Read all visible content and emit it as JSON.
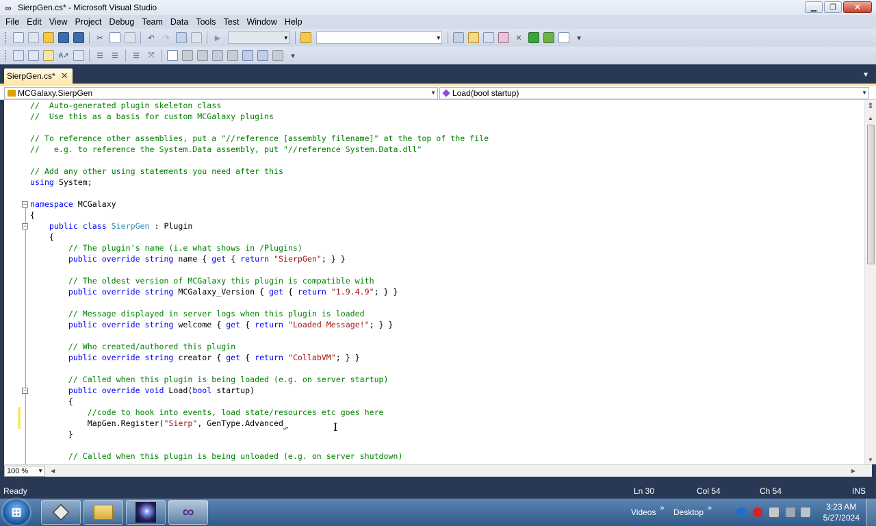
{
  "window": {
    "title": "SierpGen.cs* - Microsoft Visual Studio",
    "controls": {
      "minimize": "▁",
      "maximize": "❐",
      "close": "✕"
    }
  },
  "menu": [
    "File",
    "Edit",
    "View",
    "Project",
    "Debug",
    "Team",
    "Data",
    "Tools",
    "Test",
    "Window",
    "Help"
  ],
  "document_tab": {
    "label": "SierpGen.cs*",
    "close": "✕"
  },
  "navbar": {
    "type_selector": "MCGalaxy.SierpGen",
    "member_selector": "Load(bool startup)"
  },
  "code_lines": [
    [
      [
        "cm",
        "//  Auto-generated plugin skeleton class"
      ]
    ],
    [
      [
        "cm",
        "//  Use this as a basis for custom MCGalaxy plugins"
      ]
    ],
    [],
    [
      [
        "cm",
        "// To reference other assemblies, put a \"//reference [assembly filename]\" at the top of the file"
      ]
    ],
    [
      [
        "cm",
        "//   e.g. to reference the System.Data assembly, put \"//reference System.Data.dll\""
      ]
    ],
    [],
    [
      [
        "cm",
        "// Add any other using statements you need after this"
      ]
    ],
    [
      [
        "kw",
        "using"
      ],
      [
        "pl",
        " System;"
      ]
    ],
    [],
    [
      [
        "kw",
        "namespace"
      ],
      [
        "pl",
        " MCGalaxy"
      ]
    ],
    [
      [
        "pl",
        "{"
      ]
    ],
    [
      [
        "pl",
        "    "
      ],
      [
        "kw",
        "public class"
      ],
      [
        "pl",
        " "
      ],
      [
        "ty",
        "SierpGen"
      ],
      [
        "pl",
        " : Plugin"
      ]
    ],
    [
      [
        "pl",
        "    {"
      ]
    ],
    [
      [
        "pl",
        "        "
      ],
      [
        "cm",
        "// The plugin's name (i.e what shows in /Plugins)"
      ]
    ],
    [
      [
        "pl",
        "        "
      ],
      [
        "kw",
        "public override string"
      ],
      [
        "pl",
        " name { "
      ],
      [
        "kw",
        "get"
      ],
      [
        "pl",
        " { "
      ],
      [
        "kw",
        "return"
      ],
      [
        "pl",
        " "
      ],
      [
        "st",
        "\"SierpGen\""
      ],
      [
        "pl",
        "; } }"
      ]
    ],
    [],
    [
      [
        "pl",
        "        "
      ],
      [
        "cm",
        "// The oldest version of MCGalaxy this plugin is compatible with"
      ]
    ],
    [
      [
        "pl",
        "        "
      ],
      [
        "kw",
        "public override string"
      ],
      [
        "pl",
        " MCGalaxy_Version { "
      ],
      [
        "kw",
        "get"
      ],
      [
        "pl",
        " { "
      ],
      [
        "kw",
        "return"
      ],
      [
        "pl",
        " "
      ],
      [
        "st",
        "\"1.9.4.9\""
      ],
      [
        "pl",
        "; } }"
      ]
    ],
    [],
    [
      [
        "pl",
        "        "
      ],
      [
        "cm",
        "// Message displayed in server logs when this plugin is loaded"
      ]
    ],
    [
      [
        "pl",
        "        "
      ],
      [
        "kw",
        "public override string"
      ],
      [
        "pl",
        " welcome { "
      ],
      [
        "kw",
        "get"
      ],
      [
        "pl",
        " { "
      ],
      [
        "kw",
        "return"
      ],
      [
        "pl",
        " "
      ],
      [
        "st",
        "\"Loaded Message!\""
      ],
      [
        "pl",
        "; } }"
      ]
    ],
    [],
    [
      [
        "pl",
        "        "
      ],
      [
        "cm",
        "// Who created/authored this plugin"
      ]
    ],
    [
      [
        "pl",
        "        "
      ],
      [
        "kw",
        "public override string"
      ],
      [
        "pl",
        " creator { "
      ],
      [
        "kw",
        "get"
      ],
      [
        "pl",
        " { "
      ],
      [
        "kw",
        "return"
      ],
      [
        "pl",
        " "
      ],
      [
        "st",
        "\"CollabVM\""
      ],
      [
        "pl",
        "; } }"
      ]
    ],
    [],
    [
      [
        "pl",
        "        "
      ],
      [
        "cm",
        "// Called when this plugin is being loaded (e.g. on server startup)"
      ]
    ],
    [
      [
        "pl",
        "        "
      ],
      [
        "kw",
        "public override void"
      ],
      [
        "pl",
        " Load("
      ],
      [
        "kw",
        "bool"
      ],
      [
        "pl",
        " startup)"
      ]
    ],
    [
      [
        "pl",
        "        {"
      ]
    ],
    [
      [
        "pl",
        "            "
      ],
      [
        "cm",
        "//code to hook into events, load state/resources etc goes here"
      ]
    ],
    [
      [
        "pl",
        "            MapGen.Register("
      ],
      [
        "st",
        "\"Sierp\""
      ],
      [
        "pl",
        ", GenType.Advanced"
      ],
      [
        "sq",
        " "
      ]
    ],
    [
      [
        "pl",
        "        }"
      ]
    ],
    [],
    [
      [
        "pl",
        "        "
      ],
      [
        "cm",
        "// Called when this plugin is being unloaded (e.g. on server shutdown)"
      ]
    ]
  ],
  "zoom": "100 %",
  "status": {
    "message": "Ready",
    "line": "Ln 30",
    "col": "Col 54",
    "ch": "Ch 54",
    "mode": "INS"
  },
  "taskbar": {
    "start": "⊞",
    "toolbars": [
      "Videos",
      "Desktop"
    ],
    "time": "3:23 AM",
    "date": "5/27/2024"
  },
  "colors": {
    "chrome": "#293955",
    "active_tab": "#ffe8a6",
    "comment": "#008000",
    "keyword": "#0000ff",
    "type": "#2b91af",
    "string": "#a31515"
  }
}
